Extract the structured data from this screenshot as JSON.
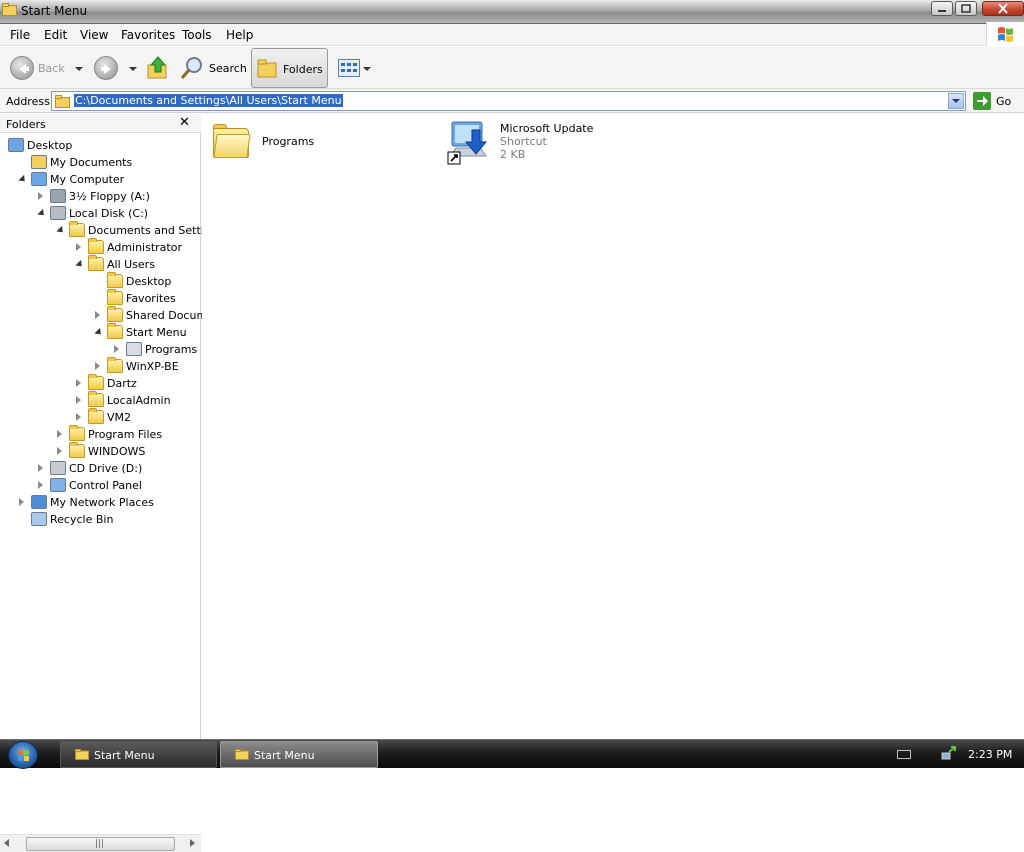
{
  "window": {
    "title": "Start Menu",
    "buttons": {
      "minimize": "minimize",
      "maximize": "maximize",
      "close": "close"
    }
  },
  "menubar": {
    "items": [
      "File",
      "Edit",
      "View",
      "Favorites",
      "Tools",
      "Help"
    ]
  },
  "toolbar": {
    "back_label": "Back",
    "search_label": "Search",
    "folders_label": "Folders"
  },
  "address": {
    "label": "Address",
    "value": "C:\\Documents and Settings\\All Users\\Start Menu",
    "go_label": "Go"
  },
  "folder_pane": {
    "title": "Folders",
    "close_glyph": "✕",
    "tree": [
      {
        "label": "Desktop",
        "level": 0,
        "icon": "desktop-icon",
        "expander": "none"
      },
      {
        "label": "My Documents",
        "level": 1,
        "icon": "my-documents-icon",
        "expander": "none"
      },
      {
        "label": "My Computer",
        "level": 1,
        "icon": "my-computer-icon",
        "expander": "open"
      },
      {
        "label": "3½ Floppy (A:)",
        "level": 2,
        "icon": "floppy-drive-icon",
        "expander": "closed"
      },
      {
        "label": "Local Disk (C:)",
        "level": 2,
        "icon": "hard-disk-icon",
        "expander": "open"
      },
      {
        "label": "Documents and Settings",
        "level": 3,
        "icon": "folder-icon",
        "expander": "open"
      },
      {
        "label": "Administrator",
        "level": 4,
        "icon": "folder-icon",
        "expander": "closed"
      },
      {
        "label": "All Users",
        "level": 4,
        "icon": "folder-icon",
        "expander": "open"
      },
      {
        "label": "Desktop",
        "level": 5,
        "icon": "folder-icon",
        "expander": "none"
      },
      {
        "label": "Favorites",
        "level": 5,
        "icon": "folder-icon",
        "expander": "none"
      },
      {
        "label": "Shared Documents",
        "level": 5,
        "icon": "folder-icon",
        "expander": "closed"
      },
      {
        "label": "Start Menu",
        "level": 5,
        "icon": "folder-icon",
        "expander": "open"
      },
      {
        "label": "Programs",
        "level": 6,
        "icon": "programs-folder-icon",
        "expander": "closed"
      },
      {
        "label": "WinXP-BE",
        "level": 5,
        "icon": "folder-icon",
        "expander": "closed"
      },
      {
        "label": "Dartz",
        "level": 4,
        "icon": "folder-icon",
        "expander": "closed"
      },
      {
        "label": "LocalAdmin",
        "level": 4,
        "icon": "folder-icon",
        "expander": "closed"
      },
      {
        "label": "VM2",
        "level": 4,
        "icon": "folder-icon",
        "expander": "closed"
      },
      {
        "label": "Program Files",
        "level": 3,
        "icon": "folder-icon",
        "expander": "closed"
      },
      {
        "label": "WINDOWS",
        "level": 3,
        "icon": "folder-icon",
        "expander": "closed"
      },
      {
        "label": "CD Drive (D:)",
        "level": 2,
        "icon": "cd-drive-icon",
        "expander": "closed"
      },
      {
        "label": "Control Panel",
        "level": 2,
        "icon": "control-panel-icon",
        "expander": "closed"
      },
      {
        "label": "My Network Places",
        "level": 1,
        "icon": "network-places-icon",
        "expander": "closed"
      },
      {
        "label": "Recycle Bin",
        "level": 1,
        "icon": "recycle-bin-icon",
        "expander": "none"
      }
    ],
    "scroll_grip": "|||"
  },
  "content": {
    "items": [
      {
        "name": "Programs",
        "icon": "large-folder-icon"
      },
      {
        "name": "Microsoft Update",
        "type": "Shortcut",
        "size": "2 KB",
        "icon": "microsoft-update-icon"
      }
    ]
  },
  "taskbar": {
    "buttons": [
      {
        "label": "Start Menu",
        "active": false
      },
      {
        "label": "Start Menu",
        "active": true
      }
    ],
    "clock": "2:23 PM"
  }
}
